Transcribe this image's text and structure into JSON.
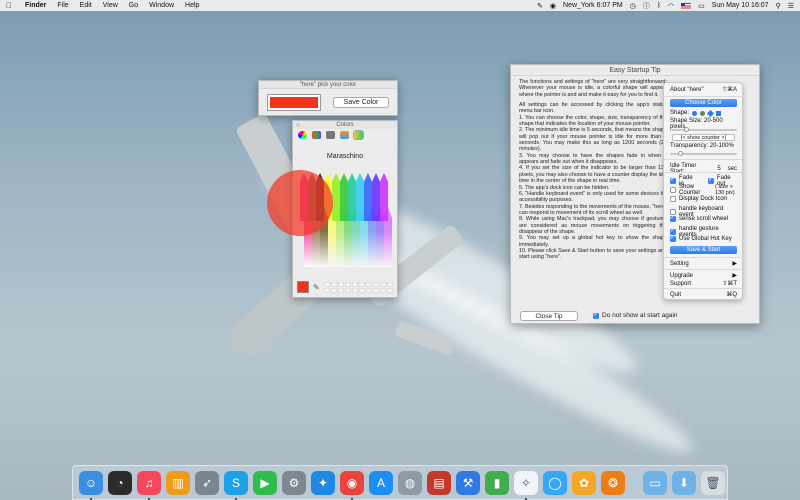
{
  "menubar": {
    "apple_icon": "apple-logo-icon",
    "items": [
      "Finder",
      "File",
      "Edit",
      "View",
      "Go",
      "Window",
      "Help"
    ],
    "clock_label": "New_York 6:07 PM",
    "datetime": "Sun May 10  16:07"
  },
  "pick_window": {
    "title": "\"here\" pick your color",
    "save_label": "Save Color",
    "color": "#f2351a"
  },
  "colors_panel": {
    "title": "Colors",
    "crayon_name": "Maraschino",
    "current_color": "#f2351a"
  },
  "tip_window": {
    "title": "Easy Startup Tip",
    "paragraphs": [
      "The functions and settings of \"here\" are very straightforward: Whenever your mouse is idle, a colorful shape will appear where the pointer is and and make it easy for you to find it.",
      "All settings can be accessed by clicking the app's status menu bar icon.",
      "1.    You can choose the color, shape, size, transparency of the shape that indicates the location of your mouse pointer.",
      "2.   The minimum idle time is 5 seconds, that means the shape will pop out if your mouse pointer is idle for more than 5 seconds. You may make this as long as 1200 seconds (20 minutes).",
      "3.   You may choose to have the shapes fade in when it appears and fade out when it disappears.",
      "4.   If you set the size of the indicator to be larger than 130 pixels, you may also choose to have a counter display the idle time in the center of the shape in real time.",
      "5.   The app's dock icon can be hidden.",
      "6.   \"Handle keyboard event\" is only used for some devices for accessibility purposes.",
      "7.   Besides responding to the movements of the mouse, \"here\" can respond to movement of its scroll wheel as well.",
      "8.   While using Mac's trackpad, you may choose if gestures are considered as mouse movements on triggering the disappear of the shape.",
      "9.   You may set up a global hot key to show the shape immediately.",
      "10.  Please click Save & Start button to save your settings and start using \"here\"."
    ],
    "close_label": "Close Tip",
    "dont_show_label": "Do not show at start again"
  },
  "menu": {
    "about": "About \"here\"",
    "about_shortcut": "⇧⌘A",
    "choose_color": "Choose Color",
    "shape_label": "Shape:",
    "shape_size": "Shape Size: 20-500 pixels",
    "show_counter_btn": "|< show counter >|",
    "transparency": "Transparency: 20-100%",
    "idle_timer_label": "Idle Timer Start:",
    "idle_timer_value": "5",
    "idle_timer_unit": "sec",
    "fade_in": "Fade in",
    "fade_out": "Fade out",
    "show_counter": "Show Counter",
    "size_note": "( size > 130 pix)",
    "display_dock_icon": "Display Dock Icon",
    "handle_keyboard": "handle keyboard event",
    "sense_scroll": "sense scroll wheel",
    "handle_gesture": "handle gesture events",
    "global_hotkey": "Use Global Hot Key",
    "save_start": "Save & Start",
    "setting": "Setting",
    "upgrade": "Upgrade",
    "support": "Support",
    "support_shortcut": "⇧⌘T",
    "quit": "Quit",
    "quit_shortcut": "⌘Q"
  },
  "dock": {
    "apps": [
      {
        "name": "finder-icon",
        "color": "#3b8fe0",
        "glyph": "☺"
      },
      {
        "name": "dashboard-icon",
        "color": "#2b2b2b",
        "glyph": "◔"
      },
      {
        "name": "music-icon",
        "color": "#f2485c",
        "glyph": "♫"
      },
      {
        "name": "books-icon",
        "color": "#f29b1a",
        "glyph": "▥"
      },
      {
        "name": "launchpad-icon",
        "color": "#7b8591",
        "glyph": "➶"
      },
      {
        "name": "skype-icon",
        "color": "#1ea1e6",
        "glyph": "S"
      },
      {
        "name": "facetime-icon",
        "color": "#2ebd4c",
        "glyph": "▶"
      },
      {
        "name": "system-preferences-icon",
        "color": "#7f8791",
        "glyph": "⚙"
      },
      {
        "name": "safari-icon",
        "color": "#1e88e5",
        "glyph": "✦"
      },
      {
        "name": "chrome-icon",
        "color": "#e8453c",
        "glyph": "◉"
      },
      {
        "name": "app-store-icon",
        "color": "#1d8ff2",
        "glyph": "A"
      },
      {
        "name": "disk-utility-icon",
        "color": "#8e9aa5",
        "glyph": "◍"
      },
      {
        "name": "notes-icon",
        "color": "#c43a2a",
        "glyph": "▤"
      },
      {
        "name": "xcode-icon",
        "color": "#2f7ae5",
        "glyph": "⚒"
      },
      {
        "name": "numbers-icon",
        "color": "#3fae4a",
        "glyph": "▮"
      },
      {
        "name": "here-app-icon",
        "color": "#f0f4f8",
        "glyph": "✧"
      },
      {
        "name": "messages-icon",
        "color": "#35a8f5",
        "glyph": "◯"
      },
      {
        "name": "photos-icon",
        "color": "#f5a623",
        "glyph": "✿"
      },
      {
        "name": "cheetah-app-icon",
        "color": "#ef7d16",
        "glyph": "❂"
      }
    ],
    "stacks": [
      {
        "name": "applications-folder-icon",
        "color": "#6fb2e8",
        "glyph": "▭"
      },
      {
        "name": "downloads-folder-icon",
        "color": "#6fb2e8",
        "glyph": "⬇"
      },
      {
        "name": "trash-icon",
        "color": "#d9dde0",
        "glyph": "🗑"
      }
    ]
  }
}
